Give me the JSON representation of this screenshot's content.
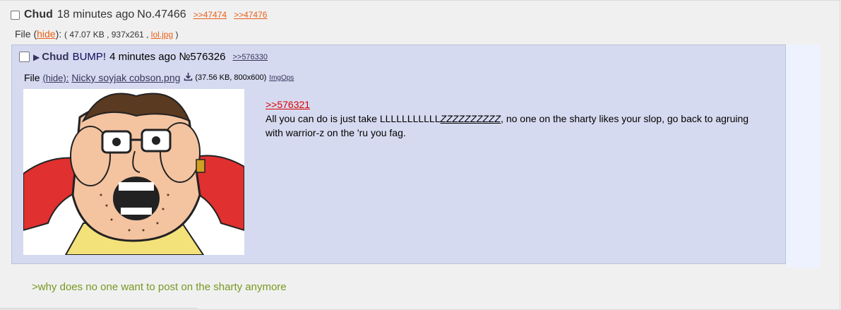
{
  "post": {
    "name": "Chud",
    "time": "18 minutes ago",
    "number": "No.47466",
    "backlinks": [
      ">>47474",
      ">>47476"
    ],
    "file_label": "File",
    "hide_label": "hide",
    "file_meta": "( 47.07 KB , 937x261 , ",
    "file_name": "lol.jpg",
    "file_meta_end": " )"
  },
  "reply": {
    "name": "Chud",
    "subject": "BUMP!",
    "time": "4 minutes ago",
    "number": "№576326",
    "backlink": ">>576330",
    "file_label": "File",
    "hide_label": "(hide):",
    "file_name": "Nicky soyjak cobson.png",
    "download_icon": "download-icon",
    "file_meta": "(37.56 KB, 800x600)",
    "imgops_label": "ImgOps",
    "quote": ">>576321",
    "body_prefix": "All you can do is just take LLLLLLLLLLL",
    "body_zzz": "ZZZZZZZZZZ",
    "body_suffix": ", no one on the sharty likes your slop, go back to agruing with warrior-z on the 'ru you fag."
  },
  "greentext": ">why does no one want to post on the sharty anymore",
  "colors": {
    "link_orange": "#e8601a",
    "reply_bg": "#d6daf0",
    "name_blue": "#34345c",
    "quote_red": "#dd0000",
    "greentext": "#789922"
  }
}
